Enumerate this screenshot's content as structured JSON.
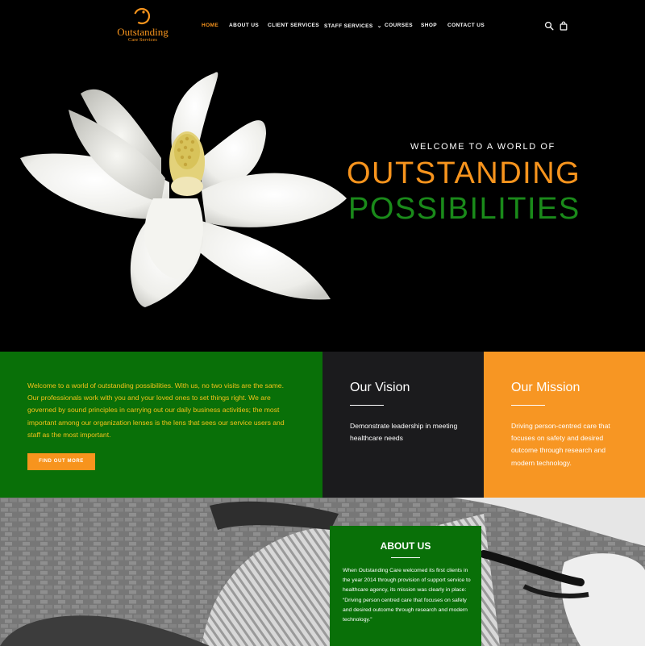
{
  "brand": {
    "name": "Outstanding",
    "tagline": "Care Services",
    "accent_orange": "#f7941d",
    "accent_green": "#097008"
  },
  "nav": {
    "items": [
      {
        "label": "HOME",
        "active": true
      },
      {
        "label": "ABOUT US",
        "active": false
      },
      {
        "label": "CLIENT SERVICES",
        "active": false
      },
      {
        "label": "STAFF SERVICES",
        "active": false
      },
      {
        "label": "COURSES",
        "active": false
      },
      {
        "label": "SHOP",
        "active": false
      },
      {
        "label": "CONTACT US",
        "active": false
      }
    ],
    "staff_dropdown_glyph": "⌄",
    "icons": [
      "search-icon",
      "shopping-bag-icon"
    ]
  },
  "hero": {
    "kicker": "WELCOME TO A WORLD OF",
    "headline_line1": "OUTSTANDING",
    "headline_line2": "POSSIBILITIES",
    "image": "white-magnolia-flower"
  },
  "intro": {
    "text": "Welcome to a world of outstanding possibilities. With us, no two visits are the same. Our professionals work with you and your loved ones to set things right. We are governed by sound principles in carrying out our daily business activities; the most important among our organization lenses is the lens that sees our service users and staff as the most important.",
    "button_label": "FIND OUT MORE"
  },
  "vision": {
    "title": "Our Vision",
    "text": "Demonstrate leadership in meeting healthcare needs"
  },
  "mission": {
    "title": "Our Mission",
    "text": "Driving person-centred care that focuses on safety and desired outcome through research and modern technology."
  },
  "about": {
    "title": "ABOUT US",
    "text": "When Outstanding Care welcomed its first clients in the year 2014 through provision of support service to healthcare agency, its mission was clearly in place: “Driving person centred care that focuses on safety and desired outcome through research and modern technology.”",
    "image": "person-on-bicycle-grayscale"
  }
}
